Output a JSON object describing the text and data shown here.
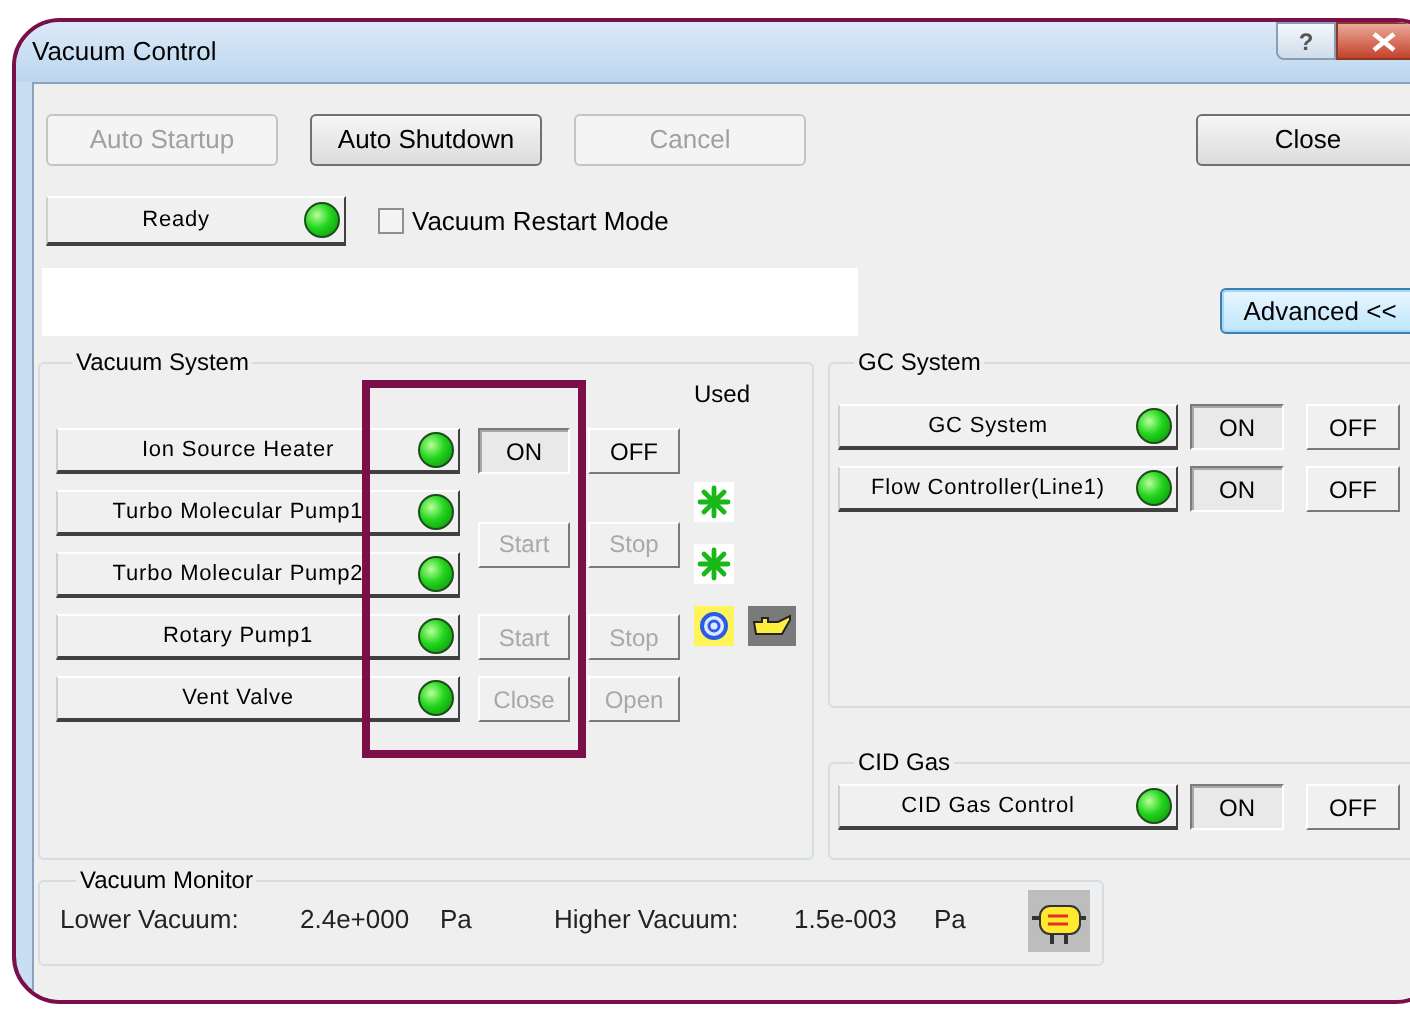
{
  "window": {
    "title": "Vacuum Control",
    "help": "?"
  },
  "toolbar": [
    {
      "label": "Auto Startup",
      "disabled": true
    },
    {
      "label": "Auto Shutdown",
      "disabled": false
    },
    {
      "label": "Cancel",
      "disabled": true
    }
  ],
  "close_button": {
    "label": "Close"
  },
  "status": {
    "text": "Ready",
    "on": true
  },
  "restart_mode": {
    "label": "Vacuum Restart Mode",
    "checked": false
  },
  "advanced_button": {
    "label": "Advanced <<"
  },
  "vacuum_system": {
    "title": "Vacuum System",
    "used_header": "Used",
    "rows": [
      {
        "name": "Ion Source Heater",
        "on": true,
        "kind": "single",
        "buttons": [
          {
            "label": "ON",
            "selected": true,
            "disabled": false
          },
          {
            "label": "OFF",
            "selected": false,
            "disabled": false
          }
        ]
      },
      {
        "name": "Turbo Molecular Pump1",
        "on": true,
        "kind": "span",
        "buttons": [
          {
            "label": "Start",
            "selected": false,
            "disabled": true
          },
          {
            "label": "Stop",
            "selected": false,
            "disabled": true
          }
        ],
        "used": [
          {
            "kind": "turbo"
          }
        ]
      },
      {
        "name": "Turbo Molecular Pump2",
        "on": true,
        "kind": "none",
        "used": [
          {
            "kind": "turbo"
          }
        ]
      },
      {
        "name": "Rotary Pump1",
        "on": true,
        "kind": "single",
        "buttons": [
          {
            "label": "Start",
            "selected": false,
            "disabled": true
          },
          {
            "label": "Stop",
            "selected": false,
            "disabled": true
          }
        ],
        "used": [
          {
            "kind": "rotary"
          },
          {
            "kind": "oil"
          }
        ]
      },
      {
        "name": "Vent Valve",
        "on": true,
        "kind": "single",
        "buttons": [
          {
            "label": "Close",
            "selected": false,
            "disabled": true
          },
          {
            "label": "Open",
            "selected": false,
            "disabled": true
          }
        ]
      }
    ]
  },
  "gc_system": {
    "title": "GC System",
    "rows": [
      {
        "name": "GC System",
        "on": true,
        "buttons": [
          {
            "label": "ON",
            "selected": true,
            "disabled": false
          },
          {
            "label": "OFF",
            "selected": false,
            "disabled": false
          }
        ]
      },
      {
        "name": "Flow Controller(Line1)",
        "on": true,
        "buttons": [
          {
            "label": "ON",
            "selected": true,
            "disabled": false
          },
          {
            "label": "OFF",
            "selected": false,
            "disabled": false
          }
        ]
      }
    ]
  },
  "cid_gas": {
    "title": "CID Gas",
    "rows": [
      {
        "name": "CID Gas Control",
        "on": true,
        "buttons": [
          {
            "label": "ON",
            "selected": true,
            "disabled": false
          },
          {
            "label": "OFF",
            "selected": false,
            "disabled": false
          }
        ]
      }
    ]
  },
  "vacuum_monitor": {
    "title": "Vacuum Monitor",
    "readings": [
      {
        "label": "Lower Vacuum:",
        "value": "2.4e+000",
        "unit": "Pa"
      },
      {
        "label": "Higher Vacuum:",
        "value": "1.5e-003",
        "unit": "Pa"
      }
    ]
  }
}
